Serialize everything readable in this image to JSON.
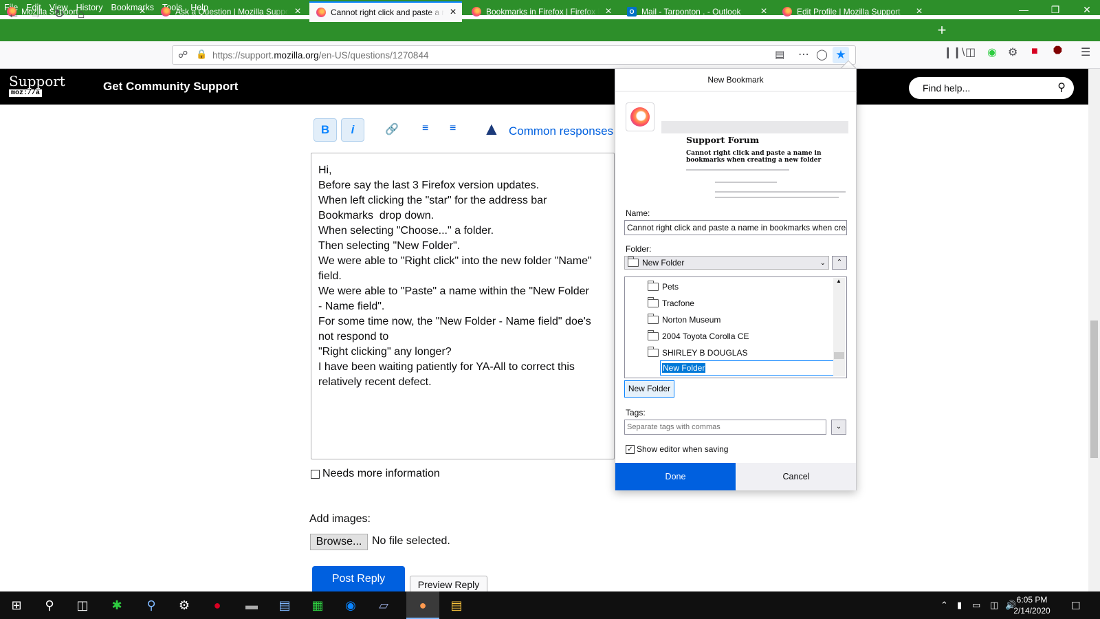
{
  "menubar": {
    "items": [
      "File",
      "Edit",
      "View",
      "History",
      "Bookmarks",
      "Tools",
      "Help"
    ]
  },
  "tabs": [
    {
      "title": "Mozilla Support",
      "icon": "firefox-icon"
    },
    {
      "title": "Ask a Question | Mozilla Support",
      "icon": "firefox-icon"
    },
    {
      "title": "Cannot right click and paste a name in bookmarks",
      "icon": "firefox-icon",
      "active": true
    },
    {
      "title": "Bookmarks in Firefox | Firefox Help",
      "icon": "firefox-icon"
    },
    {
      "title": "Mail - Tarponton . - Outlook",
      "icon": "outlook-icon"
    },
    {
      "title": "Edit Profile | Mozilla Support",
      "icon": "firefox-icon"
    }
  ],
  "navbar": {
    "url_prefix": "https://support.",
    "url_domain": "mozilla.org",
    "url_path": "/en-US/questions/1270844"
  },
  "site": {
    "logo_top": "Support",
    "logo_bottom": "moz://a",
    "heading": "Get Community Support",
    "search_placeholder": "Find help..."
  },
  "editor": {
    "bold": "B",
    "italic": "i",
    "common_responses": "Common responses",
    "lines": [
      "Hi,",
      "Before say the last 3 Firefox version updates.",
      "When left clicking the \"star\" for the address bar",
      "Bookmarks  drop down.",
      "When selecting \"Choose...\" a folder.",
      "Then selecting \"New Folder\".",
      "We were able to \"Right click\" into the new folder \"Name\"",
      "field.",
      "We were able to \"Paste\" a name within the \"New Folder",
      "- Name field\".",
      "For some time now, the \"New Folder - Name field\" doe's",
      "not respond to",
      "\"Right clicking\" any longer?",
      "I have been waiting patiently for YA-All to correct this",
      "relatively recent defect."
    ],
    "needs_more_info": "Needs more information",
    "add_images": "Add images:",
    "browse": "Browse...",
    "no_file": "No file selected.",
    "post_reply": "Post Reply",
    "preview_reply": "Preview Reply"
  },
  "bookmark_panel": {
    "title": "New Bookmark",
    "preview_title": "Support Forum",
    "preview_subtitle": "Cannot right click and paste a name in bookmarks when creating a new folder",
    "name_label": "Name:",
    "name_value": "Cannot right click and paste a name in bookmarks when creating a new folder",
    "folder_label": "Folder:",
    "folder_value": "New Folder",
    "folders": [
      "Pets",
      "Tracfone",
      "Norton Museum",
      "2004 Toyota Corolla CE",
      "SHIRLEY B DOUGLAS"
    ],
    "new_folder_edit": "New Folder",
    "new_folder_button": "New Folder",
    "tags_label": "Tags:",
    "tags_placeholder": "Separate tags with commas",
    "show_editor": "Show editor when saving",
    "show_editor_checked": true,
    "done": "Done",
    "cancel": "Cancel"
  },
  "taskbar": {
    "time": "6:05 PM",
    "date": "2/14/2020"
  },
  "colors": {
    "menubar_green": "#2d8f2a",
    "accent_blue": "#0060df",
    "site_header": "#000000"
  }
}
